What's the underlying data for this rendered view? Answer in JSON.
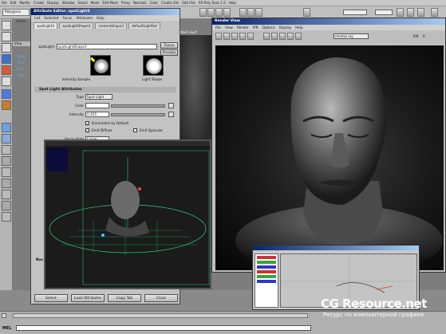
{
  "main": {
    "menu": [
      "File",
      "Edit",
      "Modify",
      "Create",
      "Display",
      "Window",
      "Select",
      "Mesh",
      "Edit Mesh",
      "Proxy",
      "Normals",
      "Color",
      "Create UVs",
      "Edit UVs",
      "PD Poly Tools 1.0",
      "Help"
    ],
    "mode": "Polygons"
  },
  "attr_editor": {
    "title": "Attribute Editor: spotLight3",
    "menu": [
      "List",
      "Selected",
      "Focus",
      "Attributes",
      "Help"
    ],
    "tabs": [
      "spotLight3",
      "spotLightShape3",
      "cameraShape3",
      "defaultLightSet"
    ],
    "node_label": "spotLight:",
    "node_value": "spotLightShape3",
    "focus_label": "Focus",
    "presets_label": "Presets",
    "intensity_sample_label": "Intensity Sample",
    "light_shape_label": "Light Shape",
    "section_title": "Spot Light Attributes",
    "type_label": "Type",
    "type_value": "Spot Light",
    "color_label": "Color",
    "intensity_label": "Intensity",
    "intensity_value": "0.455",
    "illuminates_label": "Illuminates by Default",
    "emit_diffuse_label": "Emit Diffuse",
    "emit_specular_label": "Emit Specular",
    "decay_label": "Decay Rate",
    "decay_value": "Linear",
    "lower_label": "Nos",
    "buttons": [
      "Select",
      "Load Attributes",
      "Copy Tab",
      "Close"
    ]
  },
  "render_view": {
    "title": "Render View",
    "menu": [
      "File",
      "View",
      "Render",
      "IPR",
      "Options",
      "Display",
      "Help"
    ],
    "renderer": "mental ray",
    "ipr_label": "IPR",
    "ipr_value": "0"
  },
  "panel_tabs": [
    "View",
    "Shading",
    "Lighting",
    "Show",
    "Panels"
  ],
  "side_labels": [
    "Anima",
    "Edge",
    "Brid",
    "Extr",
    "Split"
  ],
  "side_header": "Attach Surf",
  "side_header2": "AttachSurf",
  "status": {
    "mel_label": "MEL"
  },
  "watermark": {
    "brand": "CG Resource.net",
    "tagline": "Ресурс по компьютерной графике"
  }
}
